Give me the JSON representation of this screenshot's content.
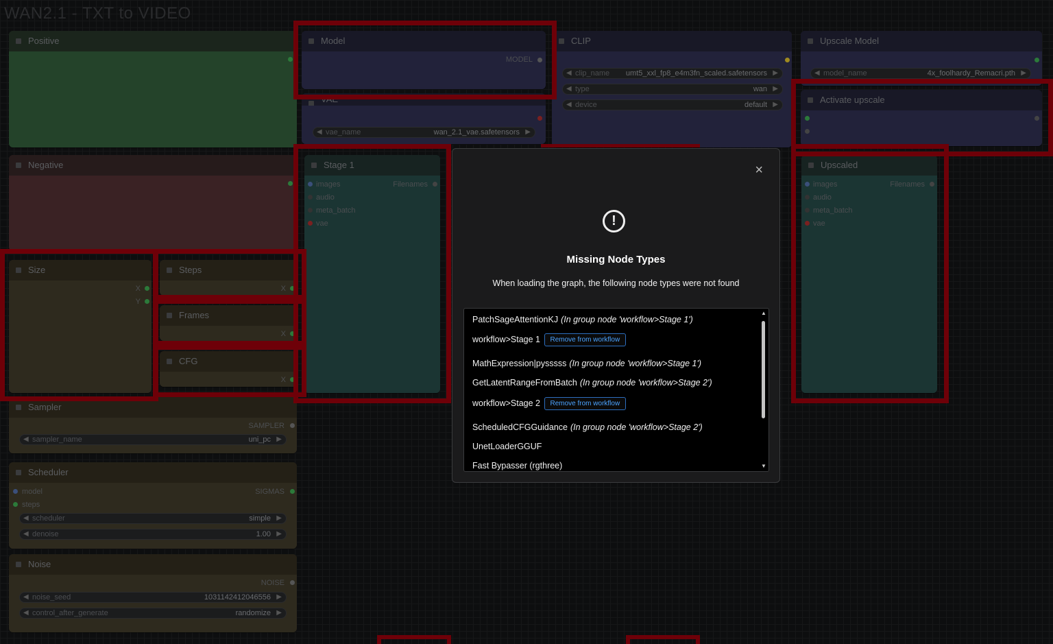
{
  "group_title": "WAN2.1 - TXT to VIDEO",
  "nodes": {
    "positive": {
      "title": "Positive"
    },
    "negative": {
      "title": "Negative"
    },
    "model": {
      "title": "Model",
      "output": "MODEL"
    },
    "vae": {
      "title": "VAE",
      "widget_name": "vae_name",
      "widget_value": "wan_2.1_vae.safetensors"
    },
    "clip": {
      "title": "CLIP",
      "widgets": [
        {
          "name": "clip_name",
          "value": "umt5_xxl_fp8_e4m3fn_scaled.safetensors"
        },
        {
          "name": "type",
          "value": "wan"
        },
        {
          "name": "device",
          "value": "default"
        }
      ]
    },
    "upscale_model": {
      "title": "Upscale Model",
      "widget_name": "model_name",
      "widget_value": "4x_foolhardy_Remacri.pth"
    },
    "activate_upscale": {
      "title": "Activate upscale"
    },
    "stage1": {
      "title": "Stage 1",
      "inputs": [
        "images",
        "audio",
        "meta_batch",
        "vae"
      ],
      "output": "Filenames"
    },
    "upscaled": {
      "title": "Upscaled",
      "inputs": [
        "images",
        "audio",
        "meta_batch",
        "vae"
      ],
      "output": "Filenames"
    },
    "size": {
      "title": "Size",
      "out_x": "X",
      "out_y": "Y"
    },
    "steps": {
      "title": "Steps",
      "out_x": "X"
    },
    "frames": {
      "title": "Frames",
      "out_x": "X"
    },
    "cfg": {
      "title": "CFG",
      "out_x": "X"
    },
    "sampler": {
      "title": "Sampler",
      "output": "SAMPLER",
      "widget_name": "sampler_name",
      "widget_value": "uni_pc"
    },
    "scheduler": {
      "title": "Scheduler",
      "inputs": [
        "model",
        "steps"
      ],
      "output": "SIGMAS",
      "widgets": [
        {
          "name": "scheduler",
          "value": "simple"
        },
        {
          "name": "denoise",
          "value": "1.00"
        }
      ]
    },
    "noise": {
      "title": "Noise",
      "output": "NOISE",
      "widgets": [
        {
          "name": "noise_seed",
          "value": "1031142412046556"
        },
        {
          "name": "control_after_generate",
          "value": "randomize"
        }
      ]
    }
  },
  "dialog": {
    "close_glyph": "×",
    "icon": "!",
    "title": "Missing Node Types",
    "description": "When loading the graph, the following node types were not found",
    "remove_label": "Remove from workflow",
    "items": [
      {
        "name": "PatchSageAttentionKJ",
        "note": "(In group node 'workflow>Stage 1')"
      },
      {
        "name": "workflow>Stage 1",
        "button": true
      },
      {
        "name": "MathExpression|pysssss",
        "note": "(In group node 'workflow>Stage 1')"
      },
      {
        "name": "GetLatentRangeFromBatch",
        "note": "(In group node 'workflow>Stage 2')"
      },
      {
        "name": "workflow>Stage 2",
        "button": true
      },
      {
        "name": "ScheduledCFGGuidance",
        "note": "(In group node 'workflow>Stage 2')"
      },
      {
        "name": "UnetLoaderGGUF",
        "note": ""
      },
      {
        "name": "Fast Bypasser (rgthree)",
        "note": ""
      }
    ]
  },
  "colors": {
    "highlight_red": "#6e0008",
    "button_blue": "#4ba3ff"
  }
}
